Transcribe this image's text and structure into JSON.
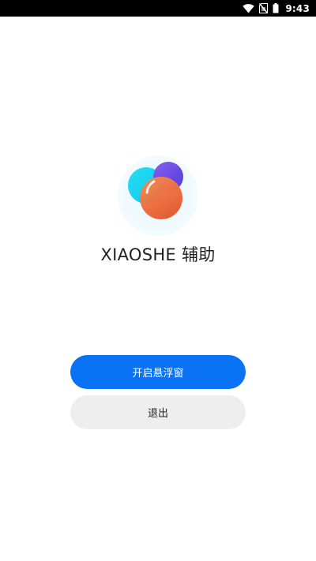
{
  "status_bar": {
    "time": "9:43",
    "icons": [
      "wifi-icon",
      "no-sim-icon",
      "battery-icon"
    ]
  },
  "app": {
    "logo_icon": "bubbles-logo-icon",
    "title": "XIAOSHE 辅助"
  },
  "actions": {
    "open_float_label": "开启悬浮窗",
    "exit_label": "退出"
  },
  "colors": {
    "primary": "#0a73f5",
    "secondary_bg": "#eeeeee",
    "bubble_cyan": "#1fd6f0",
    "bubble_purple": "#6a4de0",
    "bubble_orange": "#ec6431"
  }
}
